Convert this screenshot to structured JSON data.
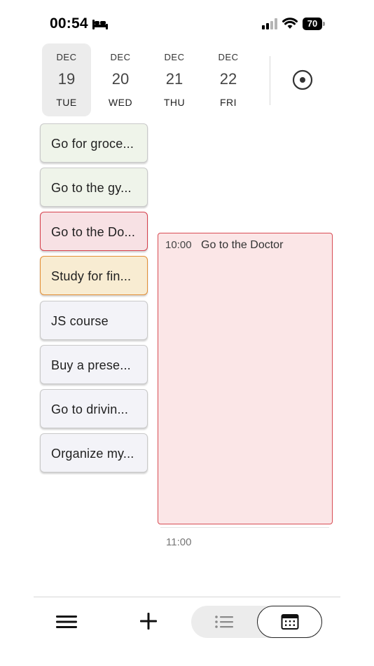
{
  "status_bar": {
    "time": "00:54",
    "battery": "70",
    "icons": [
      "bed-icon",
      "signal-icon",
      "wifi-icon",
      "battery-icon"
    ]
  },
  "days": [
    {
      "month": "DEC",
      "day": "19",
      "dow": "TUE",
      "selected": true
    },
    {
      "month": "DEC",
      "day": "20",
      "dow": "WED",
      "selected": false
    },
    {
      "month": "DEC",
      "day": "21",
      "dow": "THU",
      "selected": false
    },
    {
      "month": "DEC",
      "day": "22",
      "dow": "FRI",
      "selected": false
    }
  ],
  "tasks": [
    {
      "label": "Go for groce...",
      "color": "#eff4ea"
    },
    {
      "label": "Go to the gy...",
      "color": "#eff4ea"
    },
    {
      "label": "Go to the Do...",
      "color": "#f7e1e4"
    },
    {
      "label": "Study for fin...",
      "color": "#f8ecd2"
    },
    {
      "label": "JS course",
      "color": "#f3f3f8"
    },
    {
      "label": "Buy a prese...",
      "color": "#f3f3f8"
    },
    {
      "label": "Go to drivin...",
      "color": "#f3f3f8"
    },
    {
      "label": "Organize my...",
      "color": "#f3f3f8"
    }
  ],
  "event": {
    "time": "10:00",
    "title": "Go to the Doctor",
    "color": "#fbe6e7",
    "border": "#d84b53"
  },
  "timeline": {
    "hour_label": "11:00"
  },
  "bottom_bar": {
    "icons": [
      "menu-icon",
      "plus-icon",
      "list-view-icon",
      "calendar-view-icon"
    ],
    "active_view": "calendar"
  }
}
